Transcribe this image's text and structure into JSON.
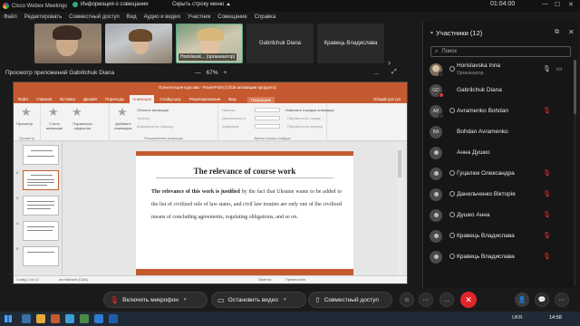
{
  "titlebar": {
    "app_name": "Cisco Webex Meetings",
    "info": "Информация о совещании",
    "hide_menu": "Скрыть строку меню",
    "timer": "01:04:00"
  },
  "menu": [
    "Файл",
    "Редактировать",
    "Совместный доступ",
    "Вид",
    "Аудио и видео",
    "Участник",
    "Совещание",
    "Справка"
  ],
  "videos": {
    "tile3_label": "Horislavsk... (организатор)",
    "tile4_name": "Gabrilchuk Diana",
    "tile5_name": "Кравець Владислава"
  },
  "share": {
    "title": "Просмотр приложений Gabrilchuk Diana",
    "zoom_out": "—",
    "zoom": "67%",
    "zoom_in": "+"
  },
  "ppt": {
    "window_title": "Презентация курсова - PowerPoint (Сбой активации продукта)",
    "tabs": [
      "Файл",
      "Главная",
      "Вставка",
      "Дизайн",
      "Переходы",
      "Анимация",
      "Слайд-шоу",
      "Рецензирование",
      "Вид"
    ],
    "active_tab": "Анимация",
    "search": "Помощник",
    "share": "Общий доступ",
    "ribbon": {
      "preview": "Просмотр",
      "preview_group": "Просмотр",
      "styles": "Стили анимации",
      "effects": "Параметры эффектов",
      "add_anim": "Добавить анимацию",
      "anim_pane": "Область анимации",
      "trigger": "Триггер",
      "painter": "Анимация по образцу",
      "ext_group": "Расширенная анимация",
      "start": "Начало:",
      "duration": "Длительность:",
      "delay": "Задержка:",
      "timing_group": "Время показа слайдов",
      "reorder": "Изменить порядок анимации",
      "move_earlier": "Переместить назад",
      "move_later": "Переместить вперед"
    },
    "thumb_nums": [
      "2",
      "3",
      "4",
      "5"
    ],
    "slide": {
      "title": "The relevance of course work",
      "bold_lead": "The relevance of this work is justified",
      "text": " by the fact that Ukraine wants to be added to the list of civilized rule of law states, and civil law treaties are only one of the civilized means of concluding agreements, regulating obligations, and so on."
    },
    "status": {
      "slide": "Слайд 2 из 12",
      "lang": "английский (США)",
      "notes": "Заметки",
      "comments": "Примечания"
    }
  },
  "panel": {
    "title": "Участники (12)",
    "search_placeholder": "Поиск",
    "participants": [
      {
        "name": "Horislavska Inna",
        "role": "Организатор",
        "avatar": "photo",
        "mic": "on"
      },
      {
        "name": "Gabrilchuk Diana",
        "role": "",
        "avatar": "GD",
        "mic": "none"
      },
      {
        "name": "Avramenko Bohdan",
        "role": "",
        "avatar": "AB",
        "mic": "off"
      },
      {
        "name": "Bohdan Avramenko",
        "role": "",
        "avatar": "BA",
        "mic": "none"
      },
      {
        "name": "Анна Душко",
        "role": "",
        "avatar": "person",
        "mic": "none"
      },
      {
        "name": "Гуцалюк Олександра",
        "role": "",
        "avatar": "person",
        "mic": "off"
      },
      {
        "name": "Данильченко Вікторія",
        "role": "",
        "avatar": "person",
        "mic": "off"
      },
      {
        "name": "Душко Анна",
        "role": "",
        "avatar": "person",
        "mic": "off"
      },
      {
        "name": "Кравець Владислава",
        "role": "",
        "avatar": "person",
        "mic": "off"
      },
      {
        "name": "Кравець Владислава",
        "role": "",
        "avatar": "person",
        "mic": "off"
      }
    ]
  },
  "controls": {
    "mic": "Включить микрофон",
    "video": "Остановить видео",
    "share": "Совместный доступ"
  },
  "taskbar": {
    "tray": "UKR",
    "clock": "14:58"
  },
  "colors": {
    "ppt_accent": "#c55a30",
    "end_call": "#e0262b",
    "muted": "#e33"
  }
}
